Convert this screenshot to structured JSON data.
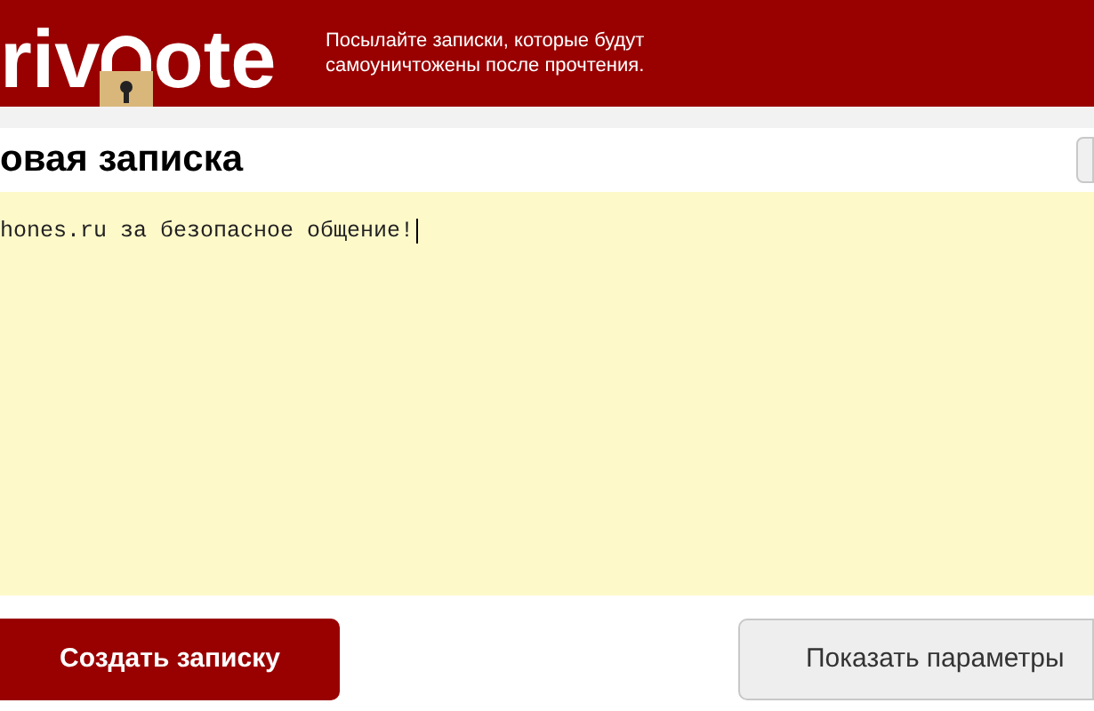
{
  "header": {
    "logo_left": "riv",
    "logo_right": "ote",
    "tagline": "Посылайте записки, которые будут самоуничтожены после прочтения."
  },
  "title": "овая записка",
  "note": {
    "value": "hones.ru за безопасное общение!"
  },
  "buttons": [
    {
      "label": "Создать записку",
      "kind": "primary"
    },
    {
      "label": "Показать параметры",
      "kind": "secondary"
    }
  ]
}
